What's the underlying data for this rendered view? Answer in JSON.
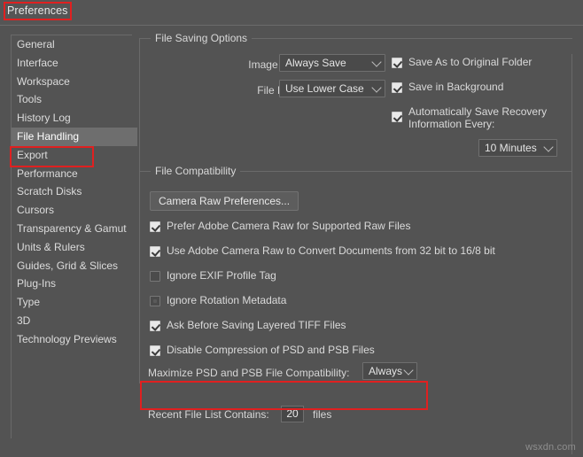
{
  "window": {
    "title": "Preferences"
  },
  "sidebar": {
    "items": [
      {
        "label": "General",
        "selected": false
      },
      {
        "label": "Interface",
        "selected": false
      },
      {
        "label": "Workspace",
        "selected": false
      },
      {
        "label": "Tools",
        "selected": false
      },
      {
        "label": "History Log",
        "selected": false
      },
      {
        "label": "File Handling",
        "selected": true
      },
      {
        "label": "Export",
        "selected": false
      },
      {
        "label": "Performance",
        "selected": false
      },
      {
        "label": "Scratch Disks",
        "selected": false
      },
      {
        "label": "Cursors",
        "selected": false
      },
      {
        "label": "Transparency & Gamut",
        "selected": false
      },
      {
        "label": "Units & Rulers",
        "selected": false
      },
      {
        "label": "Guides, Grid & Slices",
        "selected": false
      },
      {
        "label": "Plug-Ins",
        "selected": false
      },
      {
        "label": "Type",
        "selected": false
      },
      {
        "label": "3D",
        "selected": false
      },
      {
        "label": "Technology Previews",
        "selected": false
      }
    ]
  },
  "file_saving_options": {
    "group_title": "File Saving Options",
    "image_previews_label": "Image Previews:",
    "image_previews_value": "Always Save",
    "file_extension_label": "File Extension:",
    "file_extension_value": "Use Lower Case",
    "save_as_original_folder_label": "Save As to Original Folder",
    "save_as_original_folder_checked": true,
    "save_in_background_label": "Save in Background",
    "save_in_background_checked": true,
    "auto_save_recovery_line1": "Automatically Save Recovery",
    "auto_save_recovery_line2": "Information Every:",
    "auto_save_recovery_checked": true,
    "auto_save_interval_value": "10 Minutes"
  },
  "file_compatibility": {
    "group_title": "File Compatibility",
    "camera_raw_button": "Camera Raw Preferences...",
    "checkboxes": [
      {
        "label": "Prefer Adobe Camera Raw for Supported Raw Files",
        "checked": true
      },
      {
        "label": "Use Adobe Camera Raw to Convert Documents from 32 bit to 16/8 bit",
        "checked": true
      },
      {
        "label": "Ignore EXIF Profile Tag",
        "checked": false
      },
      {
        "label": "Ignore Rotation Metadata",
        "checked": false
      },
      {
        "label": "Ask Before Saving Layered TIFF Files",
        "checked": true
      },
      {
        "label": "Disable Compression of PSD and PSB Files",
        "checked": true
      }
    ],
    "maximize_label": "Maximize PSD and PSB File Compatibility:",
    "maximize_value": "Always"
  },
  "recent_files": {
    "label": "Recent File List Contains:",
    "value": "20",
    "suffix": "files"
  },
  "watermark": {
    "text": "wsxdn.com"
  },
  "colors": {
    "annotation": "#e02020",
    "panel_bg": "#535353",
    "selection_bg": "#6e6e6e"
  }
}
